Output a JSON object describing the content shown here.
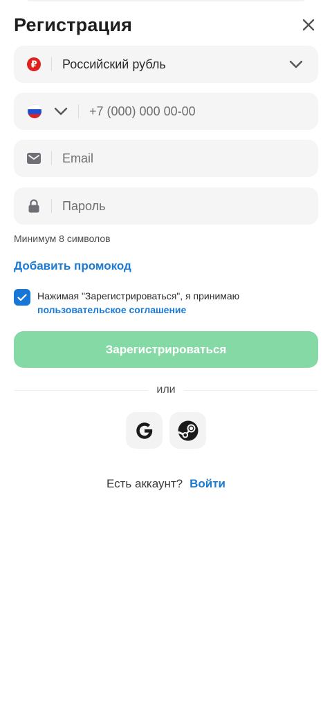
{
  "header": {
    "title": "Регистрация"
  },
  "currency": {
    "label": "Российский рубль",
    "symbol": "₽"
  },
  "phone": {
    "placeholder": "+7 (000) 000 00-00"
  },
  "email": {
    "placeholder": "Email"
  },
  "password": {
    "placeholder": "Пароль",
    "hint": "Минимум 8 символов"
  },
  "promo": {
    "link_label": "Добавить промокод"
  },
  "terms": {
    "checked": true,
    "text": "Нажимая \"Зарегистрироваться\", я принимаю",
    "link_label": "пользовательское соглашение"
  },
  "register": {
    "label": "Зарегистрироваться"
  },
  "divider": {
    "label": "или"
  },
  "login": {
    "question": "Есть аккаунт?",
    "link_label": "Войти"
  },
  "colors": {
    "accent_blue": "#1a7ad4",
    "register_green": "#84d9a4",
    "field_bg": "#f5f5f5",
    "currency_red": "#e0201c"
  },
  "icons": {
    "close": "close-icon",
    "currency": "ruble-icon",
    "flag": "russia-flag-icon",
    "email": "mail-icon",
    "password": "lock-icon",
    "google": "google-icon",
    "steam": "steam-icon"
  }
}
